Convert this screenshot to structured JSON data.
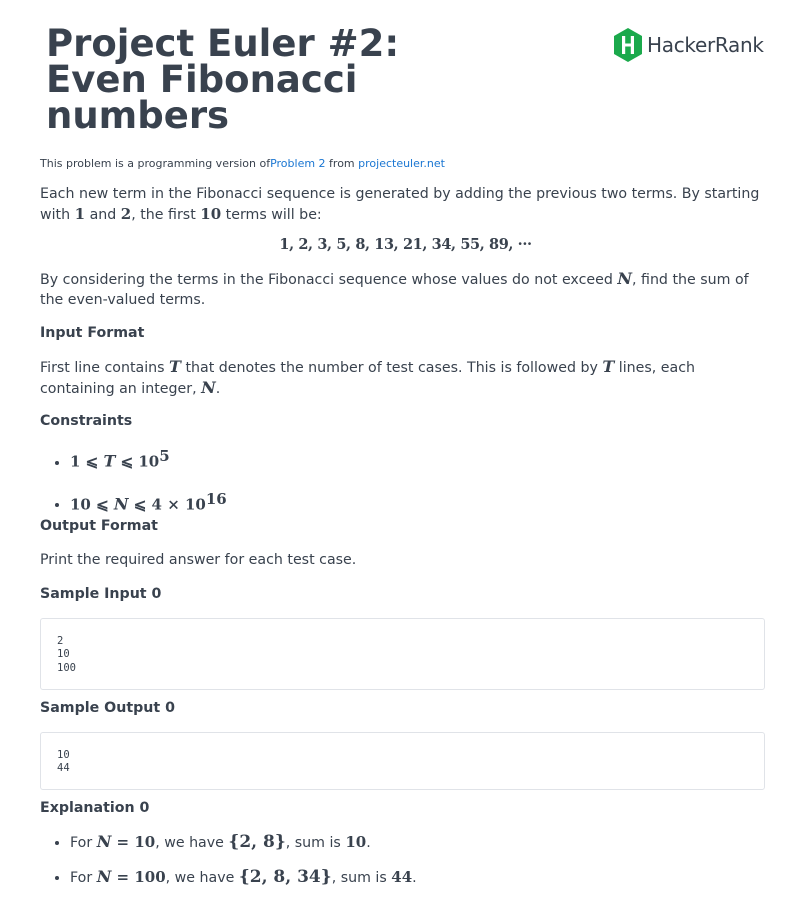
{
  "title_lines": [
    "Project Euler #2:",
    "Even Fibonacci",
    "numbers"
  ],
  "logo": {
    "text": "HackerRank",
    "icon": "hackerrank-logo-icon",
    "color": "#1ba94c"
  },
  "source": {
    "prefix": "This problem is a programming version of",
    "problem_link": "Problem 2",
    "middle": " from ",
    "site_link": "projecteuler.net"
  },
  "intro": {
    "part1": "Each new term in the Fibonacci sequence is generated by adding the previous two terms. By starting with ",
    "m1": "1",
    "part2": " and ",
    "m2": "2",
    "part3": ", the first ",
    "m3": "10",
    "part4": " terms will be:"
  },
  "sequence": "1, 2, 3, 5, 8, 13, 21, 34, 55, 89, ···",
  "task": {
    "part1": "By considering the terms in the Fibonacci sequence whose values do not exceed ",
    "m1": "N",
    "part2": ", find the sum of the even-valued terms."
  },
  "input_format": {
    "heading": "Input Format",
    "part1": "First line contains ",
    "m1": "T",
    "part2": " that denotes the number of test cases. This is followed by ",
    "m2": "T",
    "part3": " lines, each containing an integer, ",
    "m3": "N",
    "part4": "."
  },
  "constraints": {
    "heading": "Constraints",
    "c1": {
      "a": "1 ⩽ ",
      "var": "T",
      "b": " ⩽ 10",
      "sup": "5"
    },
    "c2": {
      "a": "10 ⩽ ",
      "var": "N",
      "b": " ⩽ 4 × 10",
      "sup": "16"
    }
  },
  "output_format": {
    "heading": "Output Format",
    "text": "Print the required answer for each test case."
  },
  "sample_input": {
    "heading": "Sample Input 0",
    "lines": [
      "2",
      "10",
      "100"
    ]
  },
  "sample_output": {
    "heading": "Sample Output 0",
    "lines": [
      "10",
      "44"
    ]
  },
  "explanation": {
    "heading": "Explanation 0",
    "e1": {
      "pre": "For ",
      "var": "N",
      "eq": " = 10",
      "mid": ", we have ",
      "set": "{2, 8}",
      "post": ", sum is ",
      "sum": "10",
      "end": "."
    },
    "e2": {
      "pre": "For ",
      "var": "N",
      "eq": " = 100",
      "mid": ", we have ",
      "set": "{2, 8, 34}",
      "post": ", sum is ",
      "sum": "44",
      "end": "."
    }
  }
}
